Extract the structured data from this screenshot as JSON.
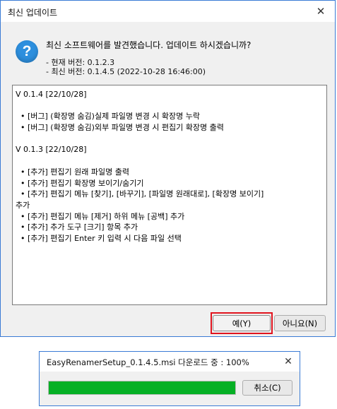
{
  "update_dialog": {
    "title": "최신 업데이트",
    "close_glyph": "✕",
    "question_icon_glyph": "?",
    "question": "최신 소프트웨어를 발견했습니다. 업데이트 하시겠습니까?",
    "current_version": "- 현재 버전: 0.1.2.3",
    "latest_version": "- 최신 버전: 0.1.4.5 (2022-10-28 16:46:00)",
    "changelog": [
      "V 0.1.4 [22/10/28]",
      "",
      "  • [버그] (확장명 숨김)실제 파일명 변경 시 확장명 누락",
      "  • [버그] (확장명 숨김)외부 파일명 변경 시 편집기 확장명 출력",
      "",
      "V 0.1.3 [22/10/28]",
      "",
      "  • [추가] 편집기 원래 파일명 출력",
      "  • [추가] 편집기 확장명 보이기/숨기기",
      "  • [추가] 편집기 메뉴 [찾기], [바꾸기], [파일명 원래대로], [확장명 보이기]",
      "추가",
      "  • [추가] 편집기 메뉴 [제거] 하위 메뉴 [공백] 추가",
      "  • [추가] 추가 도구 [크기] 항목 추가",
      "  • [추가] 편집기 Enter 키 입력 시 다음 파일 선택"
    ],
    "yes_label": "예(Y)",
    "no_label": "아니요(N)"
  },
  "download_dialog": {
    "title": "EasyRenamerSetup_0.1.4.5.msi 다운로드 중 : 100%",
    "close_glyph": "✕",
    "progress_percent": 100,
    "cancel_label": "취소(C)"
  },
  "colors": {
    "accent_border": "#3a7bd5",
    "question_icon": "#2d8fde",
    "highlight": "#e0141e",
    "progress_fill": "#06b025"
  }
}
